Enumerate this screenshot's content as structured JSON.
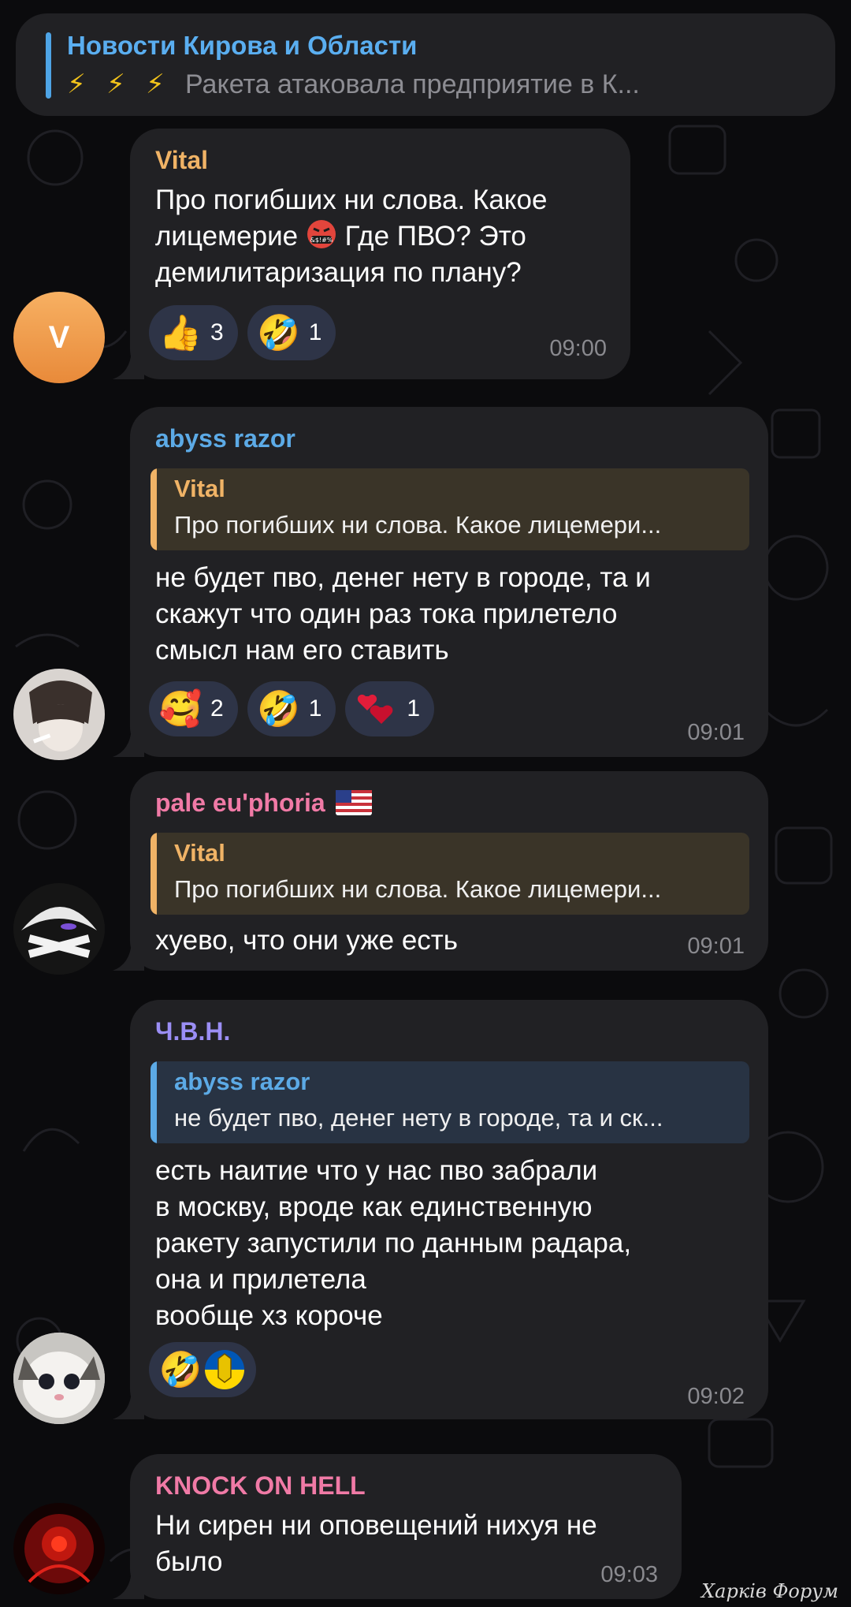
{
  "pinned": {
    "title": "Новости Кирова и Области",
    "preview": "Ракета атаковала предприятие в К...",
    "bolt_icon": "⚡"
  },
  "messages": [
    {
      "avatar_letter": "V",
      "sender": "Vital",
      "sender_color": "#f0b366",
      "lines": [
        "Про погибших ни слова. Какое",
        "лицемерие",
        " Где ПВО? Это",
        "демилитаризация по плану?"
      ],
      "reactions": [
        {
          "icon": "thumbs-up-icon",
          "glyph": "👍",
          "count": "3"
        },
        {
          "icon": "rofl-icon",
          "glyph": "🤣",
          "count": "1"
        }
      ],
      "time": "09:00"
    },
    {
      "sender": "abyss razor",
      "sender_color": "#5caae6",
      "reply": {
        "name": "Vital",
        "text": "Про погибших ни слова. Какое лицемери...",
        "color": "#f0b366",
        "bg": "#3a3428"
      },
      "lines": [
        "не будет пво, денег нету в городе, та и",
        "скажут что один раз тока прилетело",
        "смысл нам его ставить"
      ],
      "reactions": [
        {
          "icon": "smiling-face-hearts-icon",
          "glyph": "🥰",
          "count": "2"
        },
        {
          "icon": "rofl-icon",
          "glyph": "🤣",
          "count": "1"
        },
        {
          "icon": "sparkling-hearts-icon",
          "glyph": "❤",
          "count": "1"
        }
      ],
      "time": "09:01"
    },
    {
      "sender": "pale eu'phoria",
      "sender_flag": "🇺🇸",
      "sender_color": "#f07aa6",
      "reply": {
        "name": "Vital",
        "text": "Про погибших ни слова. Какое лицемери...",
        "color": "#f0b366",
        "bg": "#3a3428"
      },
      "lines": [
        "хуево, что они уже есть"
      ],
      "time": "09:01"
    },
    {
      "sender": "Ч.В.Н.",
      "sender_color": "#9b8ef5",
      "reply": {
        "name": "abyss razor",
        "text": "не будет пво, денег нету в городе, та и ск...",
        "color": "#5caae6",
        "bg": "#283343"
      },
      "lines": [
        "есть наитие что у нас пво забрали",
        "в москву, вроде как единственную",
        "ракету запустили по данным радара,",
        "она и прилетела",
        "вообще хз короче"
      ],
      "reactions": [
        {
          "icon": "rofl-icon",
          "glyph": "🤣",
          "count": ""
        },
        {
          "icon": "ukraine-emblem-icon",
          "glyph": "",
          "count": ""
        }
      ],
      "time": "09:02"
    },
    {
      "sender": "KNOCK ON HELL",
      "sender_color": "#f07aa6",
      "lines": [
        "Ни сирен ни оповещений нихуя не",
        "было"
      ],
      "time": "09:03"
    }
  ],
  "watermark": "Харків Форум"
}
